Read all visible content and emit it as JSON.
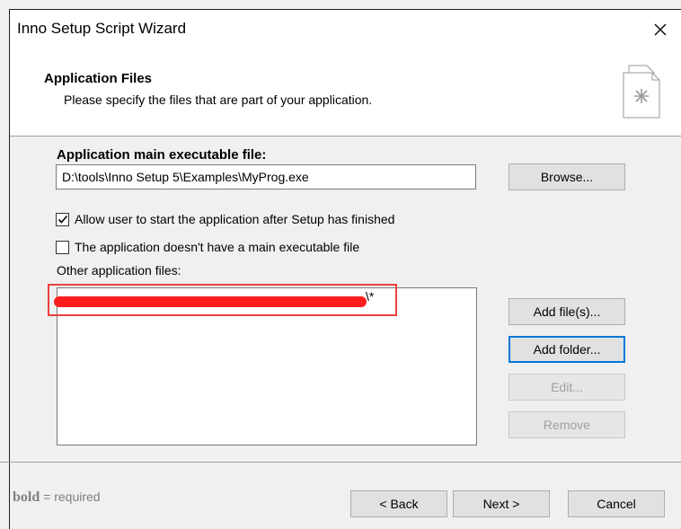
{
  "window": {
    "title": "Inno Setup Script Wizard"
  },
  "header": {
    "title": "Application Files",
    "description": "Please specify the files that are part of your application."
  },
  "main_exe": {
    "label": "Application main executable file:",
    "value": "D:\\tools\\Inno Setup 5\\Examples\\MyProg.exe",
    "browse_label": "Browse..."
  },
  "checkboxes": [
    {
      "label": "Allow user to start the application after Setup has finished",
      "checked": true
    },
    {
      "label": "The application doesn't have a main executable file",
      "checked": false
    }
  ],
  "other_files": {
    "label": "Other application files:",
    "items": [
      "\\*"
    ],
    "buttons": {
      "add_files": "Add file(s)...",
      "add_folder": "Add folder...",
      "edit": "Edit...",
      "remove": "Remove"
    }
  },
  "footer": {
    "legend_bold": "bold",
    "legend_rest": " = required",
    "back": "< Back",
    "next": "Next >",
    "cancel": "Cancel"
  }
}
